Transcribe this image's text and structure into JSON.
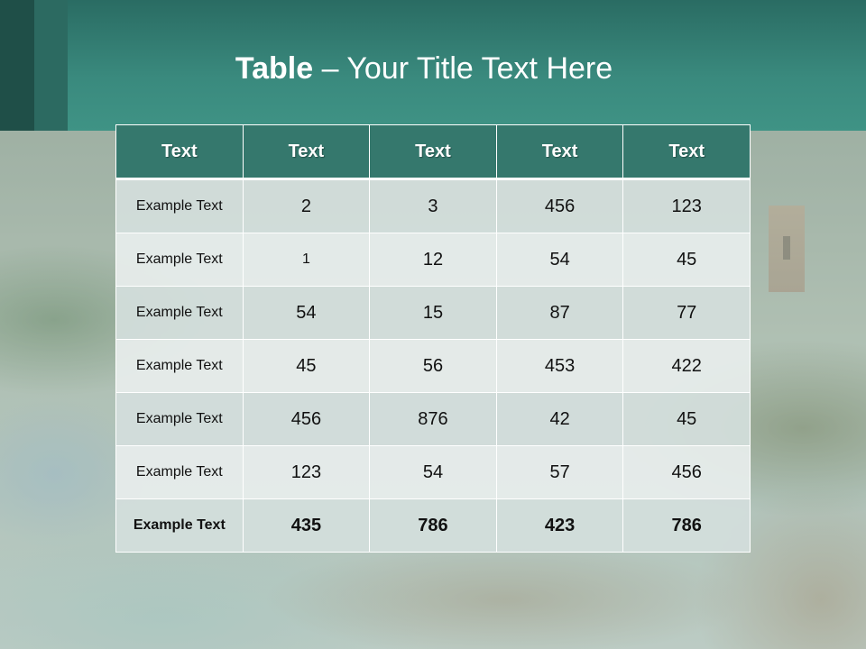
{
  "slide": {
    "title_bold": "Table",
    "title_rest": " – Your Title Text Here"
  },
  "table": {
    "headers": [
      "Text",
      "Text",
      "Text",
      "Text",
      "Text"
    ],
    "rows": [
      [
        "Example Text",
        "2",
        "3",
        "456",
        "123"
      ],
      [
        "Example Text",
        "1",
        "12",
        "54",
        "45"
      ],
      [
        "Example Text",
        "54",
        "15",
        "87",
        "77"
      ],
      [
        "Example Text",
        "45",
        "56",
        "453",
        "422"
      ],
      [
        "Example Text",
        "456",
        "876",
        "42",
        "45"
      ],
      [
        "Example Text",
        "123",
        "54",
        "57",
        "456"
      ],
      [
        "Example Text",
        "435",
        "786",
        "423",
        "786"
      ]
    ]
  },
  "colors": {
    "header_teal": "#2a6c63",
    "table_header": "#35786d"
  }
}
